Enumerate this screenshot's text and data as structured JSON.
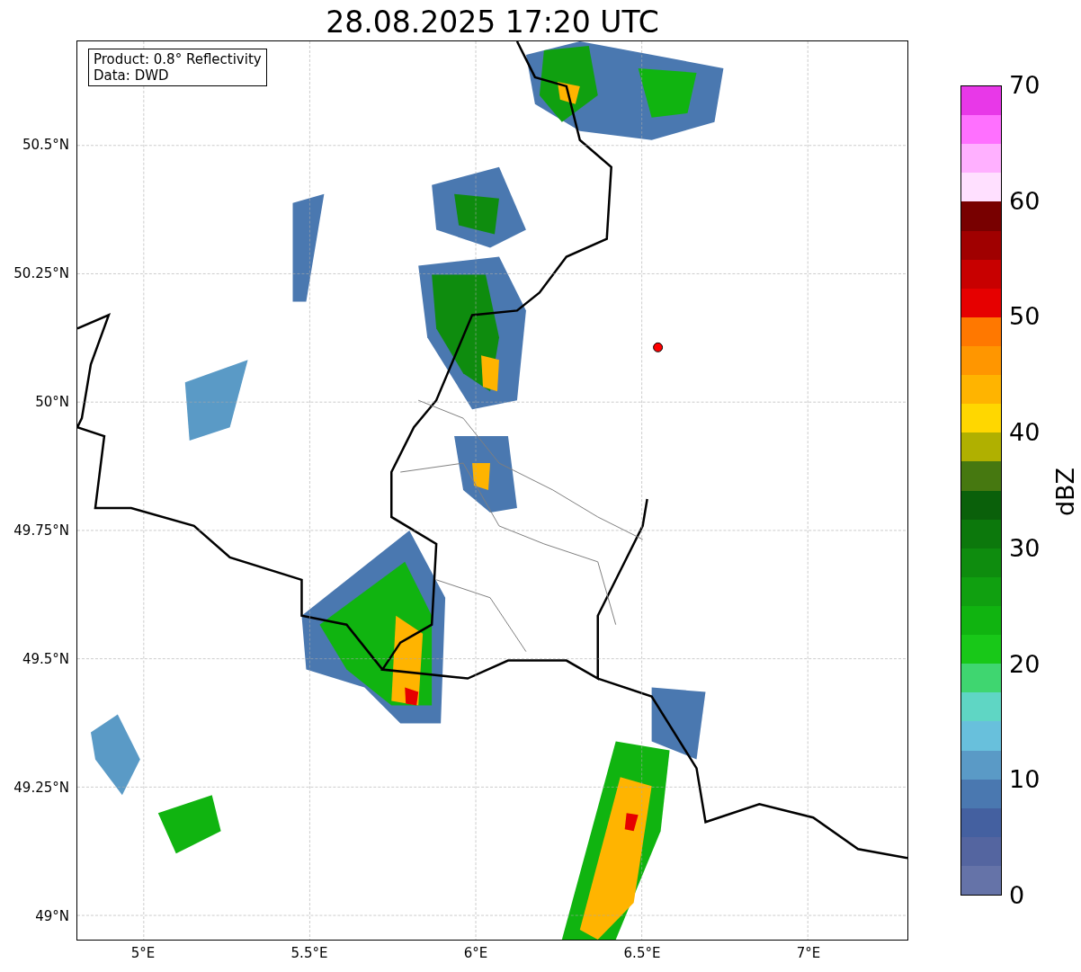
{
  "title": "28.08.2025 17:20 UTC",
  "info_box": {
    "lines": [
      "Product: 0.8° Reflectivity",
      "Data: DWD"
    ]
  },
  "y_ticks": [
    "50.5°N",
    "50.25°N",
    "50°N",
    "49.75°N",
    "49.5°N",
    "49.25°N",
    "49°N"
  ],
  "x_ticks": [
    "5°E",
    "5.5°E",
    "6°E",
    "6.5°E",
    "7°E"
  ],
  "colorbar": {
    "ticks": [
      "70",
      "60",
      "50",
      "40",
      "30",
      "20",
      "10",
      "0"
    ],
    "segments": [
      {
        "color": "#e838e8"
      },
      {
        "color": "#ff70ff"
      },
      {
        "color": "#ffb0ff"
      },
      {
        "color": "#ffe0ff"
      },
      {
        "color": "#780000"
      },
      {
        "color": "#a00000"
      },
      {
        "color": "#c80000"
      },
      {
        "color": "#e60000"
      },
      {
        "color": "#ff7800"
      },
      {
        "color": "#ff9600"
      },
      {
        "color": "#ffb400"
      },
      {
        "color": "#ffd700"
      },
      {
        "color": "#b0b000"
      },
      {
        "color": "#467810"
      },
      {
        "color": "#0a600a"
      },
      {
        "color": "#0c780c"
      },
      {
        "color": "#0e8c0e"
      },
      {
        "color": "#10a010"
      },
      {
        "color": "#10b410"
      },
      {
        "color": "#18c818"
      },
      {
        "color": "#3fd670"
      },
      {
        "color": "#5fd6c4"
      },
      {
        "color": "#68c0dc"
      },
      {
        "color": "#5a9ac6"
      },
      {
        "color": "#4a78b0"
      },
      {
        "color": "#4460a0"
      },
      {
        "color": "#5465a0"
      },
      {
        "color": "#6573a8"
      }
    ],
    "label": "dBZ"
  }
}
